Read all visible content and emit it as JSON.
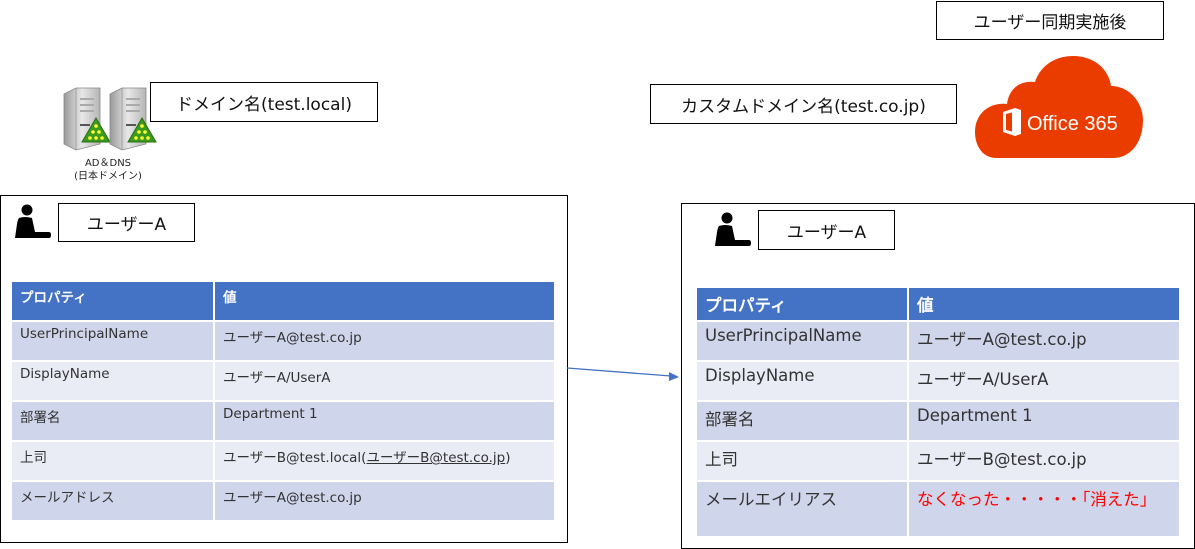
{
  "header": {
    "sync_label": "ユーザー同期実施後"
  },
  "onprem": {
    "domain_label": "ドメイン名(test.local)",
    "server_caption_line1": "AD＆DNS",
    "server_caption_line2": "(日本ドメイン)",
    "user_label": "ユーザーA",
    "table": {
      "headers": [
        "プロパティ",
        "値"
      ],
      "rows": [
        {
          "property": "UserPrincipalName",
          "value": "ユーザーA@test.co.jp"
        },
        {
          "property": "DisplayName",
          "value": "ユーザーA/UserA"
        },
        {
          "property": "部署名",
          "value": "Department 1"
        },
        {
          "property": "上司",
          "value": "ユーザーB@test.local(",
          "value_underlined": "ユーザーB@test.co.jp",
          "value_suffix": ")"
        },
        {
          "property": "メールアドレス",
          "value": "ユーザーA@test.co.jp"
        }
      ]
    }
  },
  "cloud": {
    "custom_domain_label": "カスタムドメイン名(test.co.jp)",
    "logo_text": "Office 365",
    "logo_color": "#eb3c00",
    "user_label": "ユーザーA",
    "table": {
      "headers": [
        "プロパティ",
        "値"
      ],
      "rows": [
        {
          "property": "UserPrincipalName",
          "value": "ユーザーA@test.co.jp"
        },
        {
          "property": "DisplayName",
          "value": "ユーザーA/UserA"
        },
        {
          "property": "部署名",
          "value": "Department 1"
        },
        {
          "property": "上司",
          "value": "ユーザーB@test.co.jp"
        },
        {
          "property": "メールエイリアス",
          "value": "なくなった・・・・・「消えた」",
          "highlight": true
        }
      ]
    }
  },
  "colors": {
    "table_header": "#4472c4",
    "row_odd": "#cfd5ea",
    "row_even": "#e9ebf5",
    "arrow": "#4472c4",
    "highlight_text": "#ff0000"
  }
}
